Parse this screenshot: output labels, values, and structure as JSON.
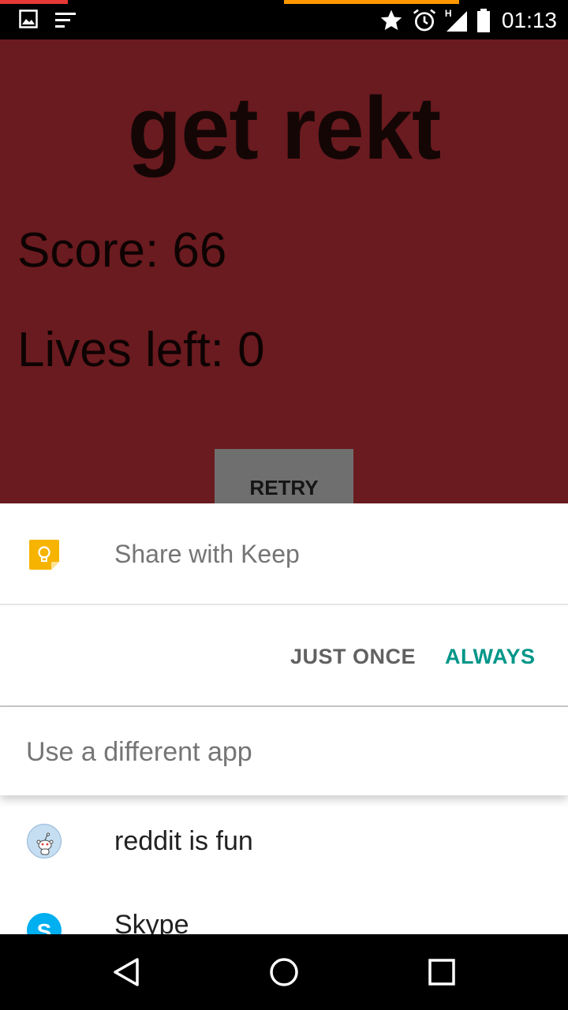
{
  "status_bar": {
    "time": "01:13",
    "network_label": "H",
    "icons_left": [
      "image-notification-icon",
      "list-notification-icon"
    ],
    "icons_right": [
      "star-icon",
      "alarm-icon",
      "signal-icon",
      "battery-icon"
    ]
  },
  "game": {
    "title": "get rekt",
    "score_text": "Score: 66",
    "lives_text": "Lives left: 0",
    "retry_label": "RETRY",
    "background_color": "#6a1b1f"
  },
  "share_sheet": {
    "keep_label": "Share with Keep",
    "just_once_label": "JUST ONCE",
    "always_label": "ALWAYS",
    "different_app_label": "Use a different app",
    "apps": [
      {
        "name": "reddit is fun",
        "icon": "reddit-icon"
      },
      {
        "name": "Skype",
        "icon": "skype-icon"
      }
    ],
    "accent_color": "#009688"
  },
  "nav_bar": {
    "buttons": [
      "back-icon",
      "home-icon",
      "recents-icon"
    ]
  }
}
